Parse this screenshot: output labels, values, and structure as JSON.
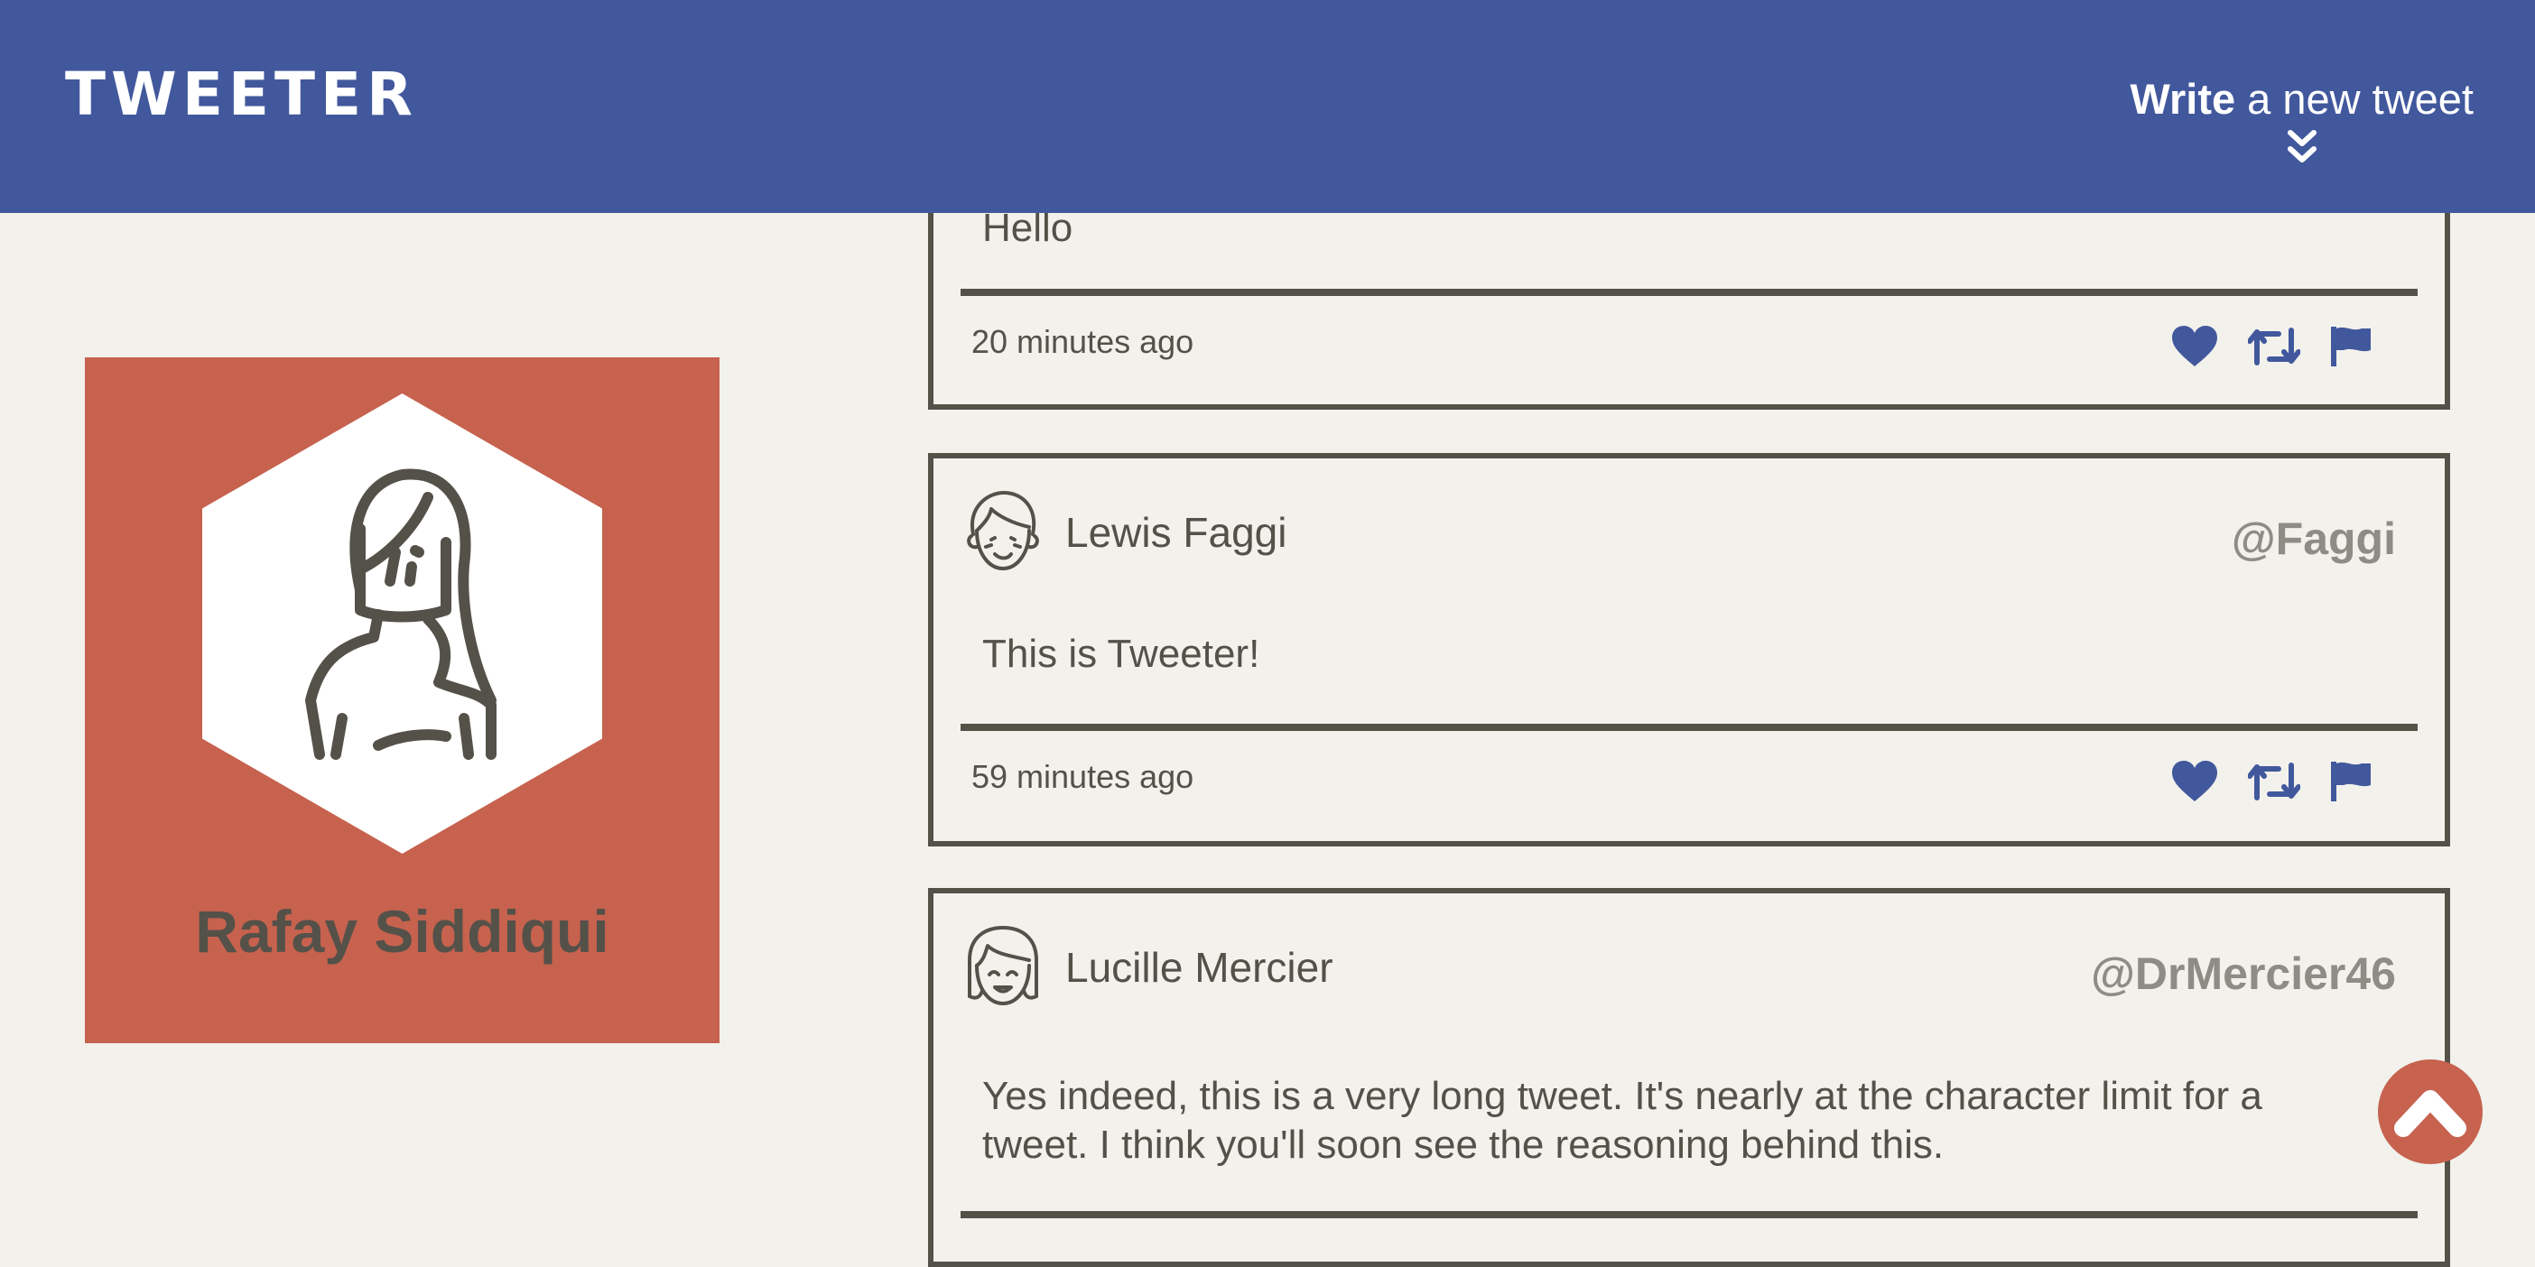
{
  "nav": {
    "brand": "TWEETER",
    "compose_strong": "Write",
    "compose_rest": " a new tweet"
  },
  "profile": {
    "name": "Rafay Siddiqui"
  },
  "tweets": [
    {
      "body": "Hello",
      "time": "20 minutes ago"
    },
    {
      "name": "Lewis Faggi",
      "handle": "@Faggi",
      "body": "This is Tweeter!",
      "time": "59 minutes ago"
    },
    {
      "name": "Lucille Mercier",
      "handle": "@DrMercier46",
      "body": "Yes indeed, this is a very long tweet. It's nearly at the character limit for a tweet. I think you'll soon see the reasoning behind this."
    }
  ],
  "icons": {
    "brand_logo": "wordmark",
    "compose": "chevron-double-down-icon",
    "like": "heart-icon",
    "retweet": "retweet-icon",
    "flag": "flag-icon",
    "scroll_top": "chevron-up-icon"
  },
  "colors": {
    "nav": "#42589d",
    "background": "#f2f1ec",
    "accent": "#c6624e",
    "text": "#545149",
    "handle": "#8f8c86",
    "action_icons": "#42589d"
  }
}
